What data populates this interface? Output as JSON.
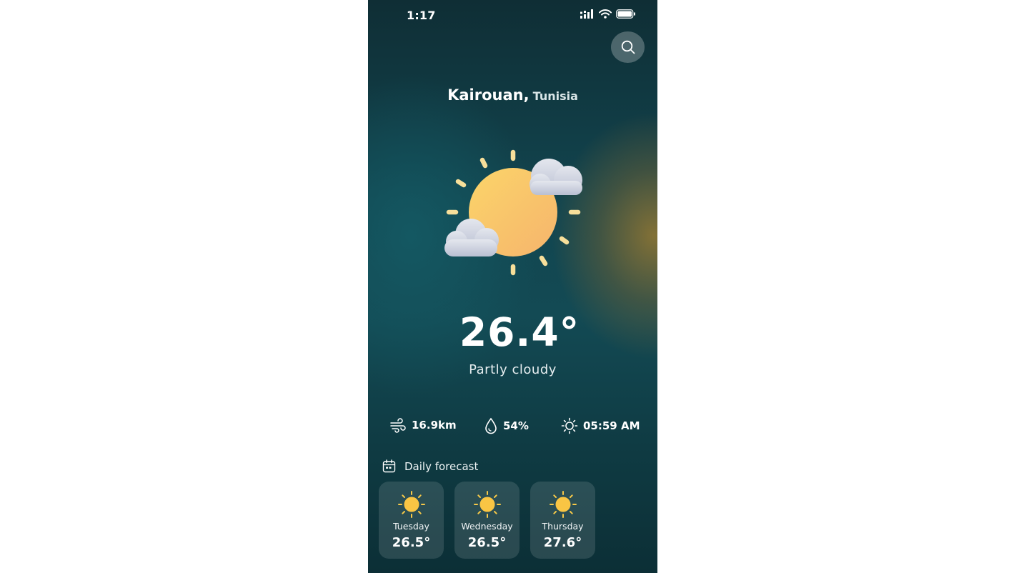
{
  "status_bar": {
    "time": "1:17",
    "icons": [
      "cellular-signal-icon",
      "wifi-icon",
      "battery-icon"
    ]
  },
  "header": {
    "search_icon": "search-icon"
  },
  "location": {
    "city": "Kairouan,",
    "country": "Tunisia"
  },
  "current": {
    "icon": "partly-cloudy-icon",
    "temperature": "26.4°",
    "condition": "Partly cloudy"
  },
  "stats": {
    "wind": {
      "icon": "wind-icon",
      "value": "16.9km"
    },
    "humidity": {
      "icon": "droplet-icon",
      "value": "54%"
    },
    "sunrise": {
      "icon": "sun-icon",
      "value": "05:59 AM"
    }
  },
  "forecast": {
    "icon": "calendar-icon",
    "title": "Daily forecast",
    "days": [
      {
        "day": "Tuesday",
        "temp": "26.5°",
        "icon": "sun-icon"
      },
      {
        "day": "Wednesday",
        "temp": "26.5°",
        "icon": "sun-icon"
      },
      {
        "day": "Thursday",
        "temp": "27.6°",
        "icon": "sun-icon"
      }
    ]
  },
  "colors": {
    "background_top": "#0f2e35",
    "background_mid": "#134a54",
    "glow": "#967832",
    "sun": "#f9c25e",
    "cloud": "#c9cfdc"
  }
}
